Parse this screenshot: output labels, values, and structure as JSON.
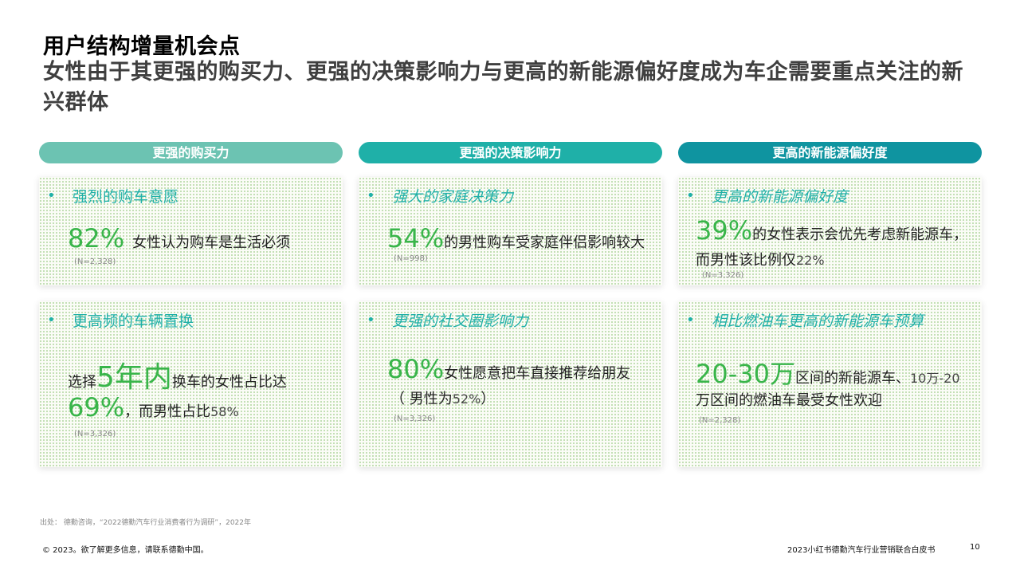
{
  "header": {
    "title": "用户结构增量机会点",
    "subtitle": "女性由于其更强的购买力、更强的决策影响力与更高的新能源偏好度成为车企需要重点关注的新兴群体"
  },
  "columns": [
    {
      "label": "更强的购买力",
      "color": "#6cc3b2"
    },
    {
      "label": "更强的决策影响力",
      "color": "#1fb0a8"
    },
    {
      "label": "更高的新能源偏好度",
      "color": "#0f94a0"
    }
  ],
  "cards": {
    "c11": {
      "bullet": "•",
      "heading": "强烈的购车意愿",
      "big": "82%",
      "text": "女性认为购车是生活必须",
      "n": "(N=2,328)"
    },
    "c12": {
      "bullet": "•",
      "heading": "强大的家庭决策力",
      "big": "54%",
      "text": "的男性购车受家庭伴侣影响较大",
      "n": "(N=998)"
    },
    "c13": {
      "bullet": "•",
      "heading": "更高的新能源偏好度",
      "big": "39%",
      "text": "的女性表示会优先考虑新能源车，",
      "text2": "而男性该比例仅",
      "text2_num": "22%",
      "n": "(N=3,326)"
    },
    "c21": {
      "bullet": "•",
      "heading": "更高频的车辆置换",
      "pre": "选择",
      "big_mid": "5年内",
      "post": "换车的女性占比达",
      "big2": "69%",
      "text2": "，而男性占比",
      "text2_num": "58%",
      "n": "(N=3,326)"
    },
    "c22": {
      "bullet": "•",
      "heading": "更强的社交圈影响力",
      "big": "80%",
      "text": "女性愿意把车直接推荐给朋友",
      "text2": "（ 男性为",
      "text2_num": "52%",
      "text2_end": " ）",
      "n": "(N=3,326)"
    },
    "c23": {
      "bullet": "•",
      "heading": "相比燃油车更高的新能源车预算",
      "big": "20-30万",
      "text": " 区间的新能源车、",
      "text_num": "10万-20",
      "text2": "万区间的燃油车最受女性欢迎",
      "n": "(N=2,328)"
    }
  },
  "footer": {
    "source": "出处：  德勤咨询，“2022德勤汽车行业消费者行为调研”，2022年",
    "copyright": "© 2023。欲了解更多信息，请联系德勤中国。",
    "report": "2023小红书德勤汽车行业营销联合白皮书",
    "page": "10"
  },
  "colors": {
    "accent_green": "#39b54a",
    "teal": "#1fb0a8"
  }
}
